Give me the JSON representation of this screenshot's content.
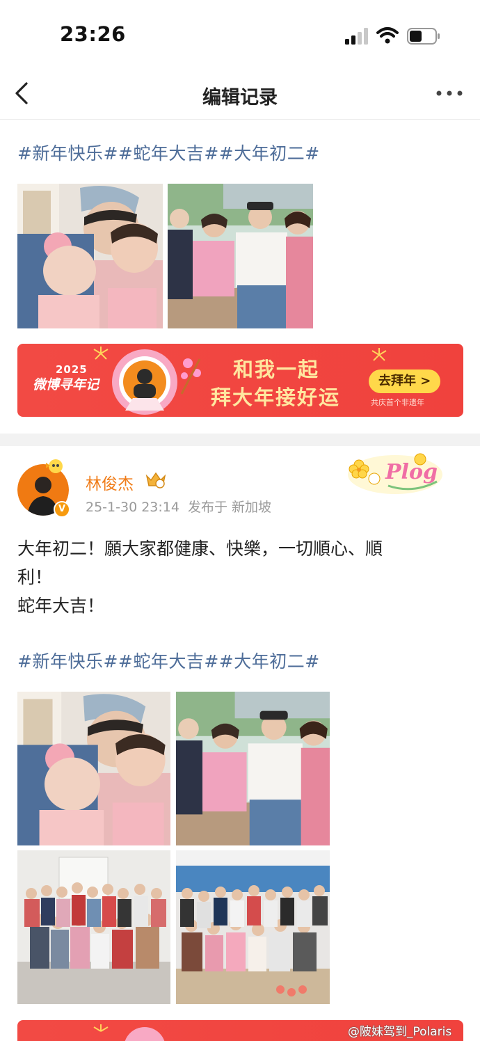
{
  "status_bar": {
    "time": "23:26"
  },
  "nav": {
    "title": "编辑记录"
  },
  "top_block": {
    "hashtags": "#新年快乐##蛇年大吉##大年初二#"
  },
  "banner": {
    "year": "2025",
    "brand": "微博寻年记",
    "slogan_line1": "和我一起",
    "slogan_line2": "拜大年接好运",
    "cta": "去拜年 >",
    "tagline": "共庆首个非遗年"
  },
  "post": {
    "author": "林俊杰",
    "timestamp": "25-1-30 23:14",
    "location": "发布于 新加坡",
    "text_lines": [
      "大年初二！願大家都健康、快樂，一切順心、順",
      "利！",
      "蛇年大吉！"
    ],
    "hashtags": "#新年快乐##蛇年大吉##大年初二#"
  },
  "icons": {
    "back": "chevron-left-icon",
    "more": "more-dots-icon",
    "verified": "verified-badge-icon",
    "crown": "vip-crown-icon",
    "sticker": "plog-sticker-icon"
  },
  "colors": {
    "hashtag": "#4e6d99",
    "author": "#f07d1a",
    "banner": "#f24a44",
    "meta": "#9a9a9a"
  },
  "watermark": "@陂妹驾到_Polaris"
}
